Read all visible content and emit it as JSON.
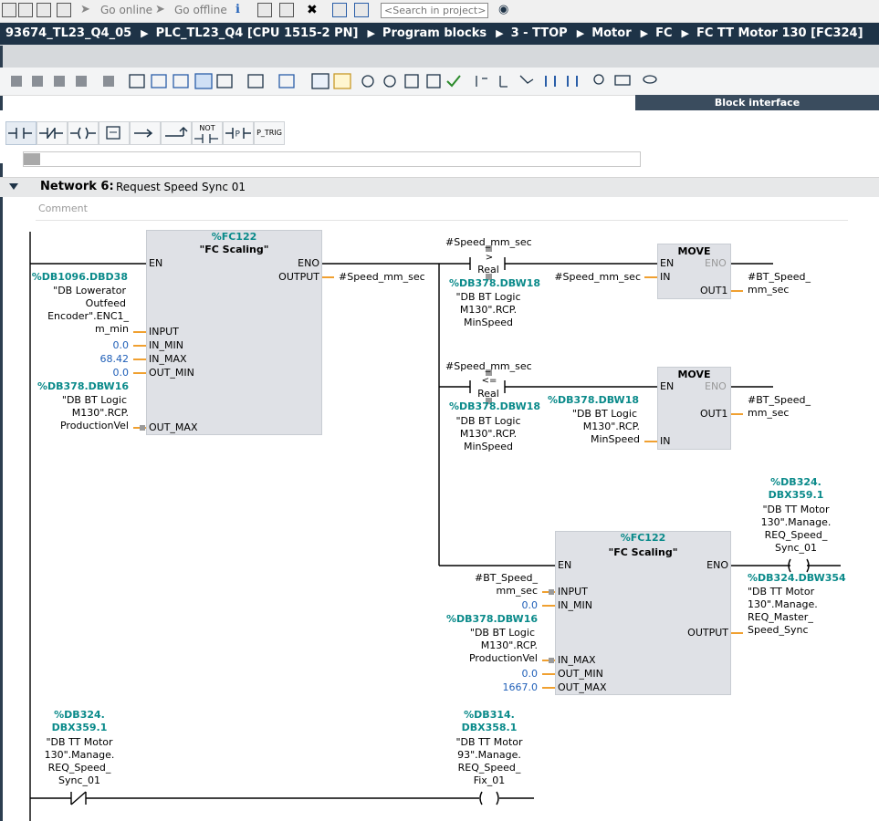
{
  "toolbar": {
    "go_online": "Go online",
    "go_offline": "Go offline",
    "search_placeholder": "<Search in project>"
  },
  "breadcrumb": [
    "93674_TL23_Q4_05",
    "PLC_TL23_Q4 [CPU 1515-2 PN]",
    "Program blocks",
    "3 - TTOP",
    "Motor",
    "FC",
    "FC TT Motor 130 [FC324]"
  ],
  "block_interface_label": "Block interface",
  "lad_palette": [
    "NOT",
    "P_TRIG"
  ],
  "network": {
    "title": "Network 6:",
    "name": "Request Speed Sync 01",
    "comment_placeholder": "Comment"
  },
  "colors": {
    "teal": "#0a8a8a",
    "blue": "#1f5fb8",
    "wire": "#000000",
    "pin": "#f0a030",
    "breadcrumb_bg": "#1e3347"
  },
  "fc122_a": {
    "addr": "%FC122",
    "name": "\"FC Scaling\"",
    "en": "EN",
    "eno": "ENO",
    "output": "OUTPUT",
    "pins": [
      "INPUT",
      "IN_MIN",
      "IN_MAX",
      "OUT_MIN",
      "OUT_MAX"
    ],
    "input_addr": "%DB1096.DBD38",
    "input_sym": [
      "\"DB Lowerator",
      "Outfeed",
      "Encoder\".ENC1_",
      "m_min"
    ],
    "in_min": "0.0",
    "in_max": "68.42",
    "out_min": "0.0",
    "out_max_addr": "%DB378.DBW16",
    "out_max_sym": [
      "\"DB BT Logic",
      "M130\".RCP.",
      "ProductionVel"
    ],
    "output_var": "#Speed_mm_sec"
  },
  "cmp_gt": {
    "var": "#Speed_mm_sec",
    "op": ">",
    "type": "Real",
    "addr": "%DB378.DBW18",
    "sym": [
      "\"DB BT Logic",
      "M130\".RCP.",
      "MinSpeed"
    ]
  },
  "move_1": {
    "title": "MOVE",
    "en": "EN",
    "eno": "ENO",
    "in": "IN",
    "out": "OUT1",
    "in_var": "#Speed_mm_sec",
    "out_var": [
      "#BT_Speed_",
      "mm_sec"
    ]
  },
  "cmp_le": {
    "var": "#Speed_mm_sec",
    "op": "<=",
    "type": "Real",
    "addr": "%DB378.DBW18",
    "sym": [
      "\"DB BT Logic",
      "M130\".RCP.",
      "MinSpeed"
    ]
  },
  "move_2": {
    "title": "MOVE",
    "en": "EN",
    "eno": "ENO",
    "in": "IN",
    "out": "OUT1",
    "in_addr": "%DB378.DBW18",
    "in_sym": [
      "\"DB BT Logic",
      "M130\".RCP.",
      "MinSpeed"
    ],
    "out_var": [
      "#BT_Speed_",
      "mm_sec"
    ]
  },
  "fc122_b": {
    "addr": "%FC122",
    "name": "\"FC Scaling\"",
    "en": "EN",
    "eno": "ENO",
    "output": "OUTPUT",
    "pins": [
      "INPUT",
      "IN_MIN",
      "IN_MAX",
      "OUT_MIN",
      "OUT_MAX"
    ],
    "input_var": [
      "#BT_Speed_",
      "mm_sec"
    ],
    "in_min": "0.0",
    "in_max_addr": "%DB378.DBW16",
    "in_max_sym": [
      "\"DB BT Logic",
      "M130\".RCP.",
      "ProductionVel"
    ],
    "out_min": "0.0",
    "out_max": "1667.0",
    "output_addr": "%DB324.DBW354",
    "output_sym": [
      "\"DB TT Motor",
      "130\".Manage.",
      "REQ_Master_",
      "Speed_Sync"
    ]
  },
  "coil_top": {
    "addr": [
      "%DB324.",
      "DBX359.1"
    ],
    "sym": [
      "\"DB TT Motor",
      "130\".Manage.",
      "REQ_Speed_",
      "Sync_01"
    ]
  },
  "contact_bottom": {
    "addr": [
      "%DB324.",
      "DBX359.1"
    ],
    "sym": [
      "\"DB TT Motor",
      "130\".Manage.",
      "REQ_Speed_",
      "Sync_01"
    ]
  },
  "coil_bottom": {
    "addr": [
      "%DB314.",
      "DBX358.1"
    ],
    "sym": [
      "\"DB TT Motor",
      "93\".Manage.",
      "REQ_Speed_",
      "Fix_01"
    ]
  }
}
